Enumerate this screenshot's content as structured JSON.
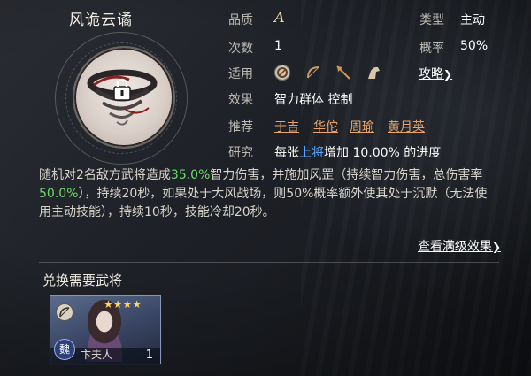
{
  "skill": {
    "title": "风诡云谲"
  },
  "info": {
    "quality_label": "品质",
    "quality_value": "A",
    "type_label": "类型",
    "type_value": "主动",
    "uses_label": "次数",
    "uses_value": "1",
    "prob_label": "概率",
    "prob_value": "50%",
    "applies_label": "适用",
    "applies_icons": [
      "shield-unit-icon",
      "bow-unit-icon",
      "spear-unit-icon",
      "cavalry-unit-icon"
    ],
    "guide_label": "攻略",
    "effect_label": "效果",
    "effect_value": "智力群体 控制",
    "recommend_label": "推荐",
    "recommend_generals": [
      "于吉",
      "华佗",
      "周瑜",
      "黄月英"
    ],
    "research_label": "研究",
    "research_prefix": "每张",
    "research_highlight": "上将",
    "research_suffix": "增加 10.00% 的进度"
  },
  "description": {
    "p1": "随机对2名敌方武将造成",
    "v1": "35.0%",
    "p2": "智力伤害，并施加风罡（持续智力伤害，总伤害率",
    "v2": "50.0%",
    "p3": "），持续20秒，如果处于大风战场，则50%概率额外使其处于沉默（无法使用主动技能），持续10秒，技能冷却20秒。"
  },
  "full_effect_link": "查看满级效果",
  "exchange": {
    "section_title": "兑换需要武将",
    "cards": [
      {
        "name": "卞夫人",
        "count": "1",
        "faction": "魏",
        "stars": "★★★★"
      }
    ]
  },
  "colors": {
    "highlight_green": "#6ddc6a",
    "highlight_blue": "#5aa7ff",
    "link_orange": "#e8a46a",
    "star_gold": "#ffd45a"
  }
}
